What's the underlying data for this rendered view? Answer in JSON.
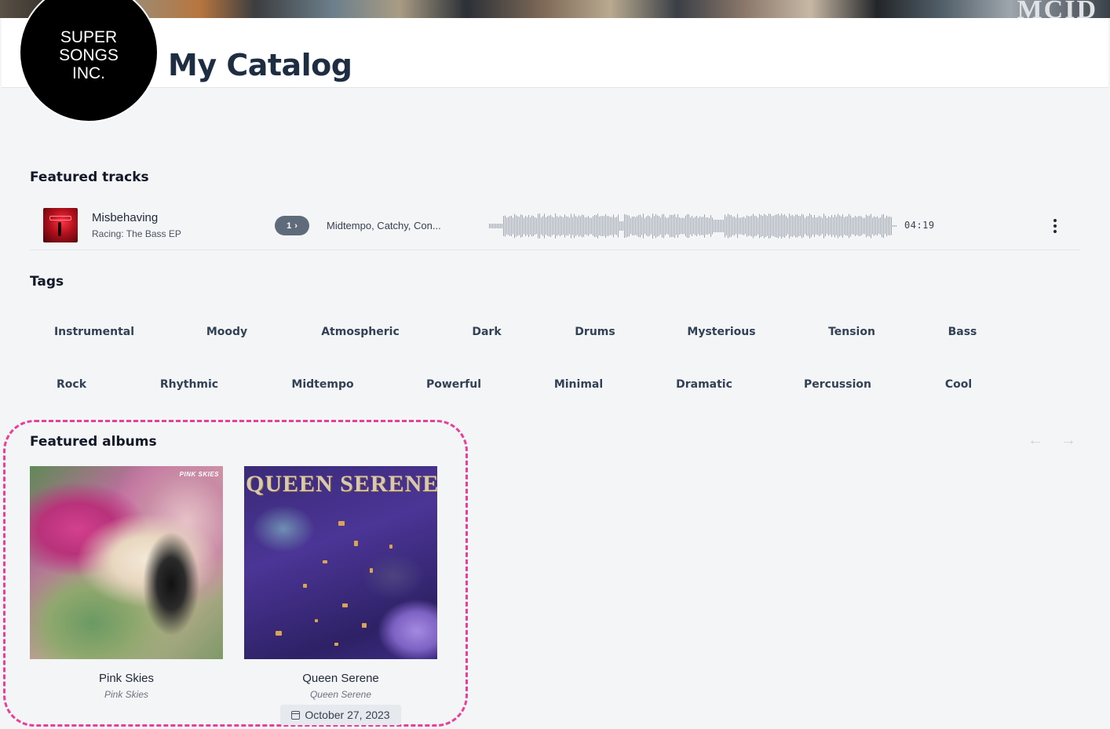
{
  "header": {
    "logo_text": "SUPER\nSONGS\nINC.",
    "banner_mark": "MCID",
    "title": "My Catalog"
  },
  "featured_tracks": {
    "heading": "Featured tracks",
    "track": {
      "title": "Misbehaving",
      "album": "Racing: The Bass EP",
      "versions": "1",
      "version_icon": "chevron-right-icon",
      "tags": "Midtempo, Catchy, Con...",
      "duration": "04:19",
      "menu_icon": "more-vertical-icon"
    }
  },
  "tags": {
    "heading": "Tags",
    "row1": [
      "Instrumental",
      "Moody",
      "Atmospheric",
      "Dark",
      "Drums",
      "Mysterious",
      "Tension",
      "Bass"
    ],
    "row2": [
      "Rock",
      "Rhythmic",
      "Midtempo",
      "Powerful",
      "Minimal",
      "Dramatic",
      "Percussion",
      "Cool"
    ]
  },
  "featured_albums": {
    "heading": "Featured albums",
    "nav": {
      "prev": "←",
      "next": "→"
    },
    "albums": [
      {
        "name": "Pink Skies",
        "artist": "Pink Skies",
        "cover_text": "PINK SKIES"
      },
      {
        "name": "Queen Serene",
        "artist": "Queen Serene",
        "cover_text": "QUEEN SERENE",
        "release_date": "October 27, 2023"
      }
    ],
    "highlight_color": "#e83f98"
  }
}
